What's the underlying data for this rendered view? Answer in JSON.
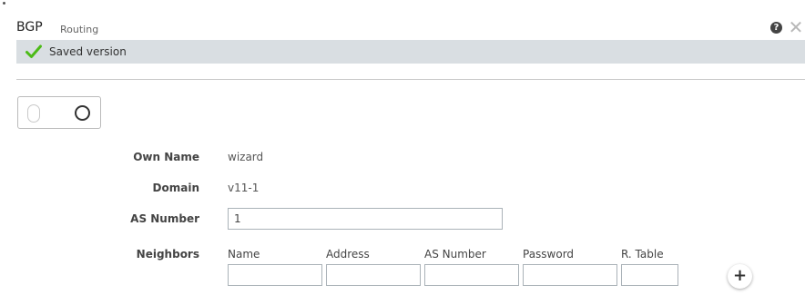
{
  "header": {
    "title": "BGP",
    "subtitle": "Routing",
    "help_icon": "question-circle-icon",
    "help_glyph": "?",
    "close_icon": "close-icon",
    "close_glyph": "✕"
  },
  "status": {
    "icon": "check-icon",
    "text": "Saved version",
    "color": "#4cbb17"
  },
  "toggle": {
    "state": "on"
  },
  "form": {
    "own_name": {
      "label": "Own Name",
      "value": "wizard"
    },
    "domain": {
      "label": "Domain",
      "value": "v11-1"
    },
    "as_number": {
      "label": "AS Number",
      "value": "1"
    },
    "neighbors": {
      "label": "Neighbors",
      "columns": [
        "Name",
        "Address",
        "AS Number",
        "Password",
        "R. Table"
      ],
      "row": [
        "",
        "",
        "",
        "",
        ""
      ]
    },
    "add_glyph": "+"
  },
  "colors": {
    "status_bar_bg": "#d9dee2",
    "check": "#4cbb17",
    "input_border": "#aab2b8"
  }
}
